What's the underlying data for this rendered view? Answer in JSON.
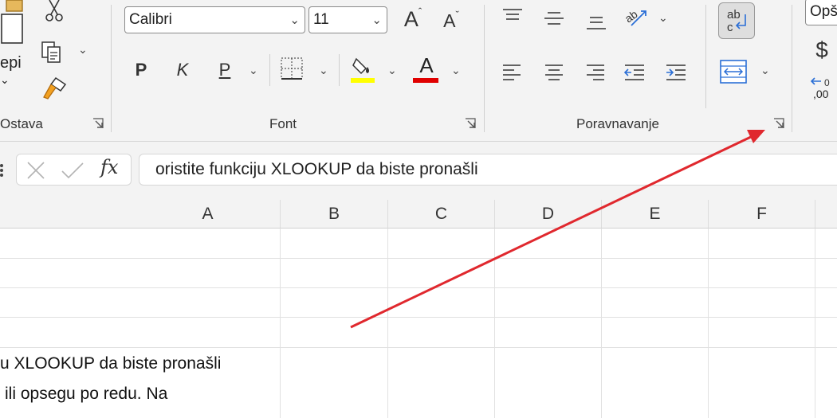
{
  "ribbon": {
    "clipboard": {
      "label": "Ostava",
      "paste_label": "epi"
    },
    "font": {
      "label": "Font",
      "font_name": "Calibri",
      "font_size": "11",
      "bold_label": "P",
      "italic_label": "K",
      "underline_label": "P",
      "font_color_label": "A",
      "highlight_color": "#ffff00",
      "font_color": "#e00000"
    },
    "alignment": {
      "label": "Poravnavanje"
    },
    "number": {
      "format": "Opš",
      "currency_symbol": "$",
      "decimal_label": ",00"
    }
  },
  "formula_bar": {
    "fx_label": "fx",
    "content": "oristite funkciju XLOOKUP da biste pronašli"
  },
  "columns": [
    "A",
    "B",
    "C",
    "D",
    "E",
    "F"
  ],
  "cells": {
    "row5_text": "u XLOOKUP da biste pronašli",
    "row6_text": "ili opsegu po redu. Na"
  },
  "annotation": {
    "arrow_color": "#e0282e"
  },
  "accent_color": "#217346"
}
